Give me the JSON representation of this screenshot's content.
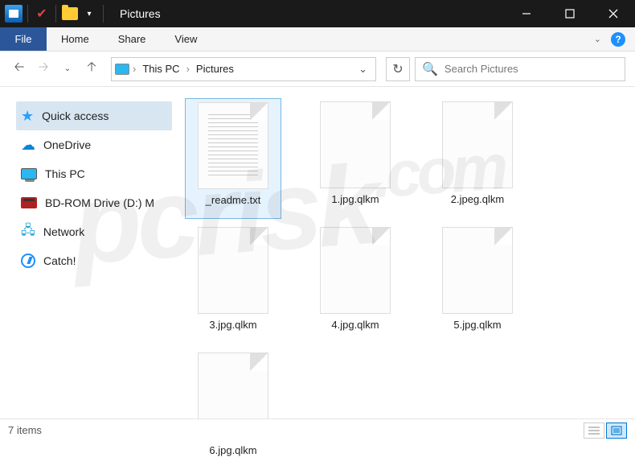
{
  "window": {
    "title": "Pictures"
  },
  "menus": {
    "file": "File",
    "home": "Home",
    "share": "Share",
    "view": "View"
  },
  "breadcrumb": {
    "root": "This PC",
    "folder": "Pictures"
  },
  "search": {
    "placeholder": "Search Pictures"
  },
  "sidebar": {
    "items": [
      {
        "label": "Quick access"
      },
      {
        "label": "OneDrive"
      },
      {
        "label": "This PC"
      },
      {
        "label": "BD-ROM Drive (D:) M"
      },
      {
        "label": "Network"
      },
      {
        "label": "Catch!"
      }
    ]
  },
  "files": [
    {
      "name": "_readme.txt",
      "type": "txt",
      "selected": true
    },
    {
      "name": "1.jpg.qlkm",
      "type": "unknown",
      "selected": false
    },
    {
      "name": "2.jpeg.qlkm",
      "type": "unknown",
      "selected": false
    },
    {
      "name": "3.jpg.qlkm",
      "type": "unknown",
      "selected": false
    },
    {
      "name": "4.jpg.qlkm",
      "type": "unknown",
      "selected": false
    },
    {
      "name": "5.jpg.qlkm",
      "type": "unknown",
      "selected": false
    },
    {
      "name": "6.jpg.qlkm",
      "type": "unknown",
      "selected": false
    }
  ],
  "status": {
    "count": "7 items"
  },
  "watermark": {
    "text": "pcrisk",
    "tld": ".com"
  }
}
